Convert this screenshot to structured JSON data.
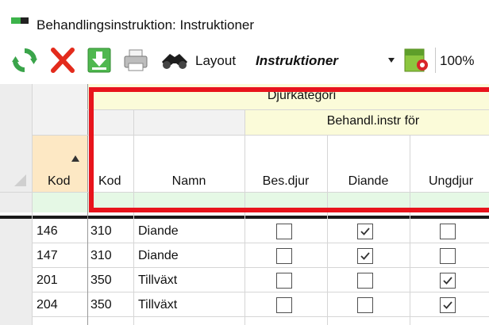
{
  "window": {
    "title": "Behandlingsinstruktion: Instruktioner"
  },
  "toolbar": {
    "refresh_icon": "refresh-icon",
    "delete_icon": "delete-icon",
    "download_icon": "download-icon",
    "print_icon": "print-icon",
    "find_icon": "binoculars-icon",
    "layout_label": "Layout",
    "layout_value": "Instruktioner",
    "settings_icon": "layout-settings-icon",
    "zoom": "100%"
  },
  "grid": {
    "group_header": "Djurkategori",
    "sub_group_header": "Behandl.instr för",
    "columns": [
      "Kod",
      "Kod",
      "Namn",
      "Bes.djur",
      "Diande",
      "Ungdjur"
    ],
    "rows": [
      {
        "kod1": "146",
        "kod2": "310",
        "namn": "Diande",
        "bes": false,
        "diande": true,
        "ungdjur": false
      },
      {
        "kod1": "147",
        "kod2": "310",
        "namn": "Diande",
        "bes": false,
        "diande": true,
        "ungdjur": false
      },
      {
        "kod1": "201",
        "kod2": "350",
        "namn": "Tillväxt",
        "bes": false,
        "diande": false,
        "ungdjur": true
      },
      {
        "kod1": "204",
        "kod2": "350",
        "namn": "Tillväxt",
        "bes": false,
        "diande": false,
        "ungdjur": true
      }
    ]
  },
  "colors": {
    "highlight": "#e8141c",
    "group_bg": "#fbfbd9",
    "filter_bg": "#e5f8e5"
  }
}
